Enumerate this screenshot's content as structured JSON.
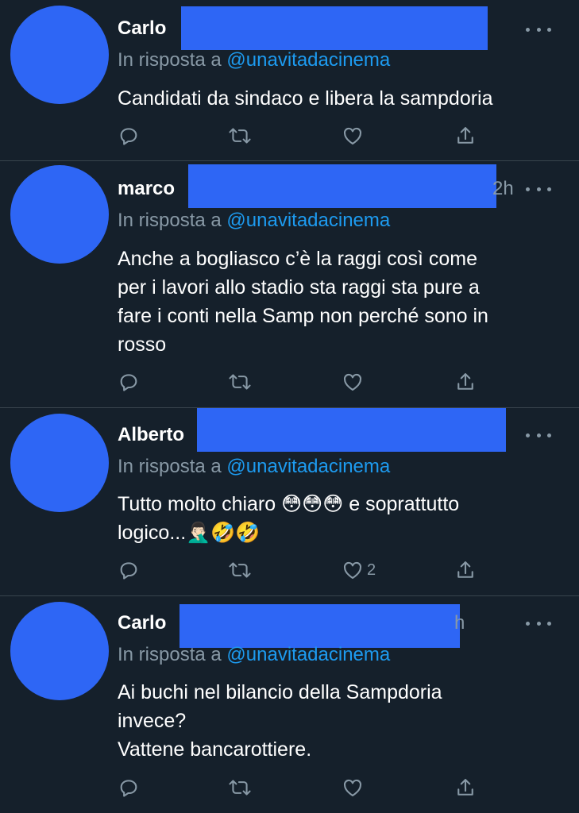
{
  "tweets": [
    {
      "name": "Carlo",
      "time": "",
      "reply_prefix": "In risposta a",
      "reply_handle": "@unavitadacinema",
      "text": "Candidati da sindaco e libera la sampdoria",
      "likes": ""
    },
    {
      "name": "marco",
      "time": "2h",
      "reply_prefix": "In risposta a",
      "reply_handle": "@unavitadacinema",
      "text": "Anche a bogliasco c’è la raggi così come\nper i lavori allo stadio sta raggi sta pure a\nfare i conti nella Samp non perché sono in\nrosso",
      "likes": ""
    },
    {
      "name": "Alberto",
      "time": "",
      "reply_prefix": "In risposta a",
      "reply_handle": "@unavitadacinema",
      "text": "Tutto molto chiaro 😳😳😳 e soprattutto\nlogico...🤦🏻‍♂️🤣🤣",
      "likes": "2"
    },
    {
      "name": "Carlo",
      "time": "h",
      "reply_prefix": "In risposta a",
      "reply_handle": "@unavitadacinema",
      "text": "Ai buchi nel bilancio della Sampdoria\ninvece?\nVattene bancarottiere.",
      "likes": ""
    }
  ],
  "colors": {
    "background": "#15202b",
    "redaction": "#2e66f5",
    "link": "#1d9bf0",
    "muted": "#8899a6",
    "divider": "#38444d"
  },
  "icons": [
    "more-icon",
    "reply-icon",
    "retweet-icon",
    "like-icon",
    "share-icon"
  ]
}
